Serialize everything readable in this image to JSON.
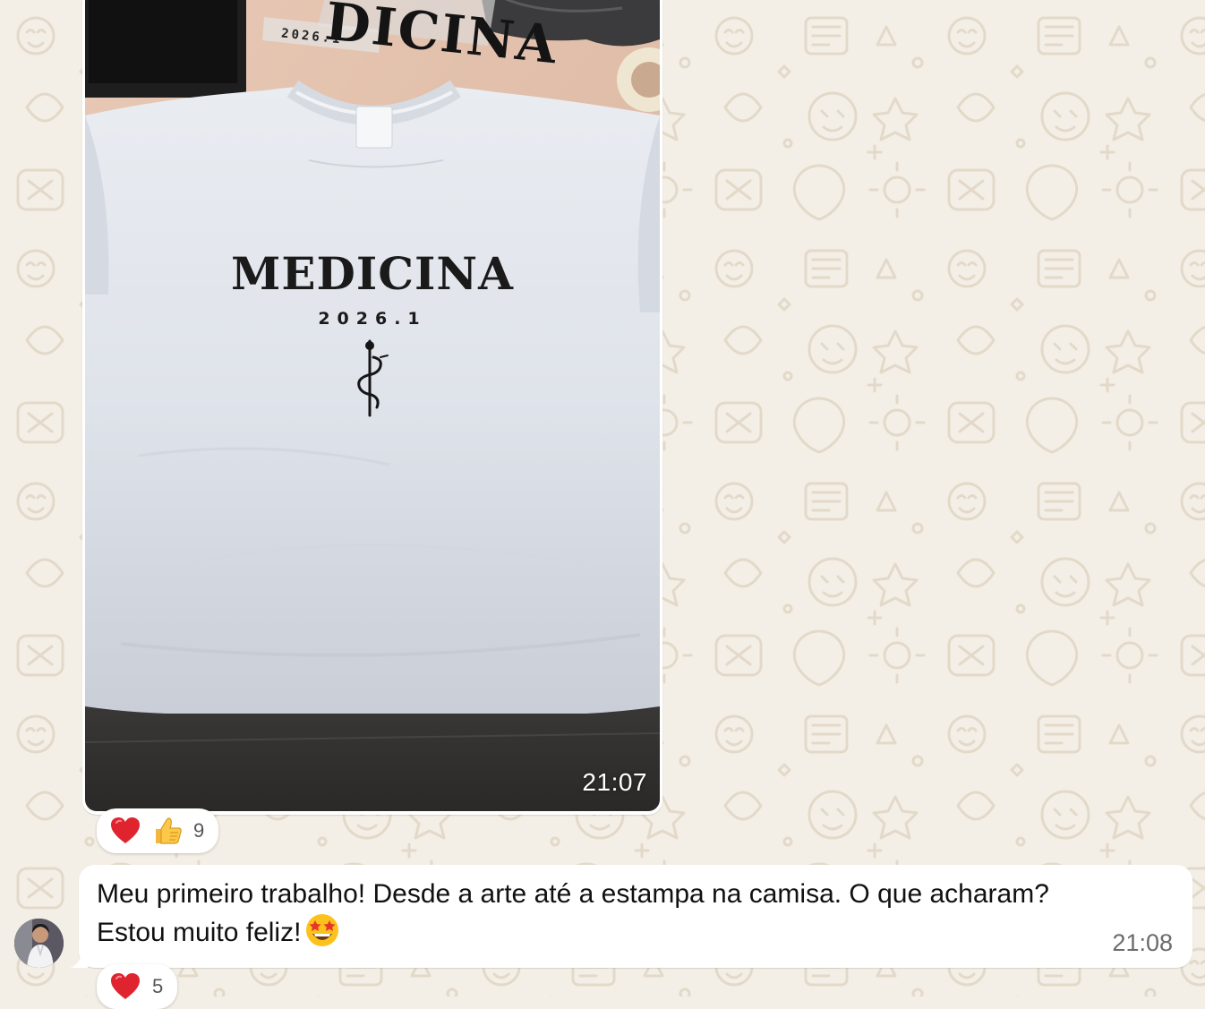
{
  "chat": {
    "background_color": "#f3eee6",
    "bubble_color": "#ffffff",
    "image_message": {
      "photo_alt": "White t-shirt with printed design",
      "shirt_print": {
        "title": "MEDICINA",
        "year": "2026.1",
        "symbol_icon": "rod-of-asclepius-icon"
      },
      "background_labels": {
        "large": "DICINA",
        "small": "2026.1"
      },
      "timestamp": "21:07",
      "reactions": {
        "items": [
          "heart",
          "thumbs-up"
        ],
        "count": "9"
      }
    },
    "text_message": {
      "line1": "Meu primeiro trabalho! Desde a arte até a estampa na camisa. O que acharam?",
      "line2": "Estou muito feliz!",
      "emoji": "star-struck",
      "timestamp": "21:08",
      "reactions": {
        "items": [
          "heart"
        ],
        "count": "5"
      }
    }
  }
}
